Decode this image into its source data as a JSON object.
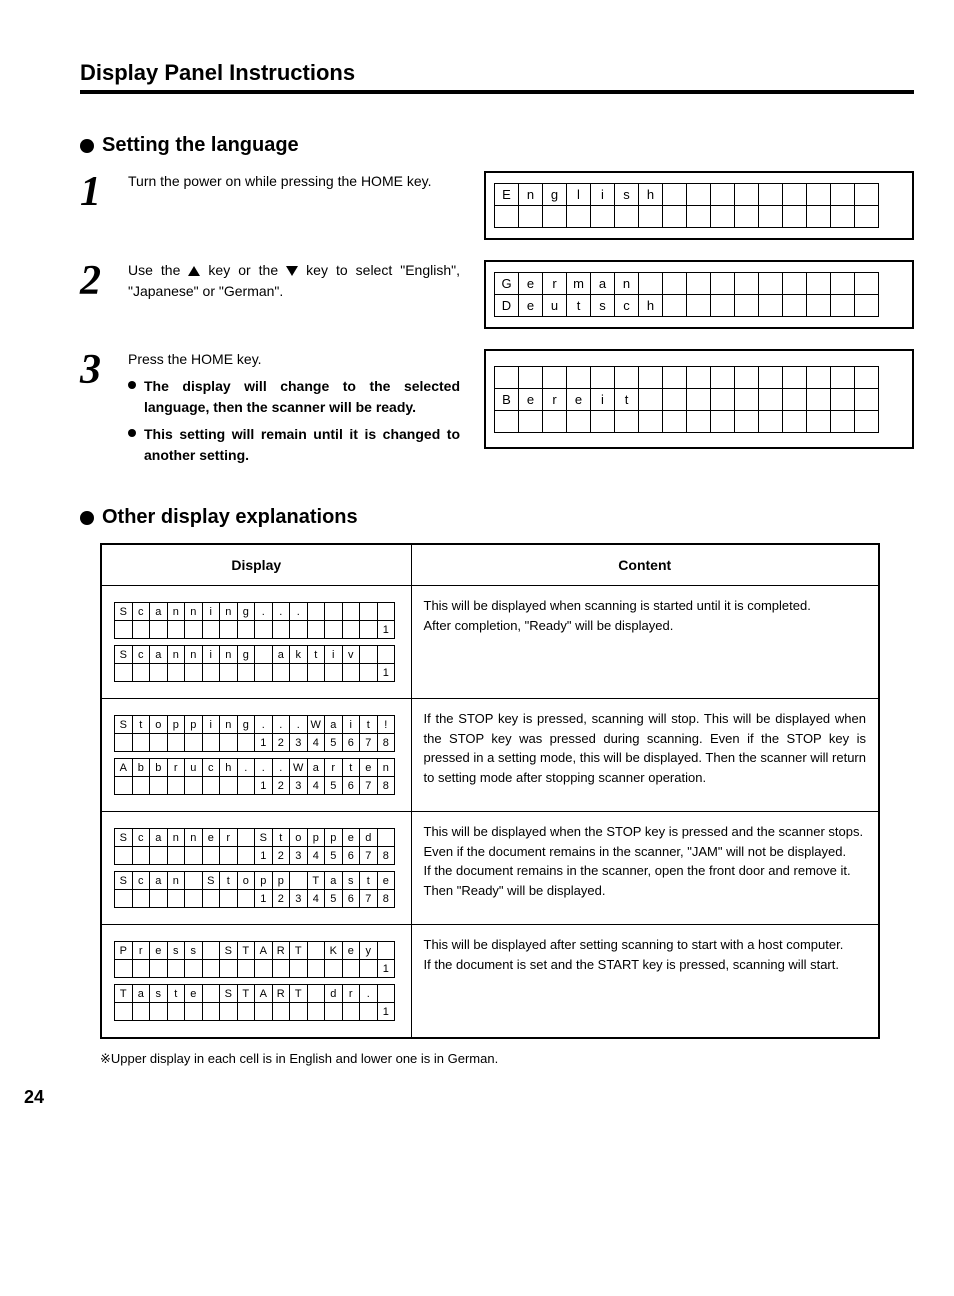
{
  "title": "Display Panel Instructions",
  "section1": {
    "heading": "Setting the language",
    "steps": [
      {
        "num": "1",
        "text": "Turn the power on while pressing the HOME key.",
        "display": {
          "rows": [
            [
              "E",
              "n",
              "g",
              "l",
              "i",
              "s",
              "h",
              "",
              "",
              "",
              "",
              "",
              "",
              "",
              "",
              ""
            ],
            [
              "",
              "",
              "",
              "",
              "",
              "",
              "",
              "",
              "",
              "",
              "",
              "",
              "",
              "",
              "",
              ""
            ]
          ]
        }
      },
      {
        "num": "2",
        "text_pre": "Use the ",
        "text_mid": " key or the ",
        "text_post": " key to select \"English\", \"Japanese\" or \"German\".",
        "display": {
          "rows": [
            [
              "G",
              "e",
              "r",
              "m",
              "a",
              "n",
              "",
              "",
              "",
              "",
              "",
              "",
              "",
              "",
              "",
              ""
            ],
            [
              "D",
              "e",
              "u",
              "t",
              "s",
              "c",
              "h",
              "",
              "",
              "",
              "",
              "",
              "",
              "",
              "",
              ""
            ]
          ]
        }
      },
      {
        "num": "3",
        "text": "Press the HOME key.",
        "subs": [
          "The display will change to the selected language, then the scanner will be ready.",
          "This setting will remain until it is changed to another setting."
        ],
        "display": {
          "rows": [
            [
              "",
              "",
              "",
              "",
              "",
              "",
              "",
              "",
              "",
              "",
              "",
              "",
              "",
              "",
              "",
              ""
            ],
            [
              "B",
              "e",
              "r",
              "e",
              "i",
              "t",
              "",
              "",
              "",
              "",
              "",
              "",
              "",
              "",
              "",
              ""
            ],
            [
              "",
              "",
              "",
              "",
              "",
              "",
              "",
              "",
              "",
              "",
              "",
              "",
              "",
              "",
              "",
              ""
            ]
          ]
        }
      }
    ]
  },
  "section2": {
    "heading": "Other display explanations",
    "col1": "Display",
    "col2": "Content",
    "rows": [
      {
        "grids": [
          [
            [
              "S",
              "c",
              "a",
              "n",
              "n",
              "i",
              "n",
              "g",
              ".",
              ".",
              ".",
              "",
              "",
              "",
              "",
              ""
            ],
            [
              "",
              "",
              "",
              "",
              "",
              "",
              "",
              "",
              "",
              "",
              "",
              "",
              "",
              "",
              "",
              "1"
            ]
          ],
          [
            [
              "S",
              "c",
              "a",
              "n",
              "n",
              "i",
              "n",
              "g",
              "",
              "a",
              "k",
              "t",
              "i",
              "v",
              "",
              ""
            ],
            [
              "",
              "",
              "",
              "",
              "",
              "",
              "",
              "",
              "",
              "",
              "",
              "",
              "",
              "",
              "",
              "1"
            ]
          ]
        ],
        "content": "This will be displayed when scanning is started until it is completed.\nAfter completion, \"Ready\" will be displayed."
      },
      {
        "grids": [
          [
            [
              "S",
              "t",
              "o",
              "p",
              "p",
              "i",
              "n",
              "g",
              ".",
              ".",
              ".",
              "W",
              "a",
              "i",
              "t",
              "!"
            ],
            [
              "",
              "",
              "",
              "",
              "",
              "",
              "",
              "",
              "1",
              "2",
              "3",
              "4",
              "5",
              "6",
              "7",
              "8"
            ]
          ],
          [
            [
              "A",
              "b",
              "b",
              "r",
              "u",
              "c",
              "h",
              ".",
              ".",
              ".",
              "W",
              "a",
              "r",
              "t",
              "e",
              "n"
            ],
            [
              "",
              "",
              "",
              "",
              "",
              "",
              "",
              "",
              "1",
              "2",
              "3",
              "4",
              "5",
              "6",
              "7",
              "8"
            ]
          ]
        ],
        "content": "If the STOP key is pressed, scanning will stop. This will be displayed when the STOP key was pressed during scanning. Even if the STOP key is pressed in a setting mode, this will be displayed. Then the scanner will return to setting mode after stopping scanner operation."
      },
      {
        "grids": [
          [
            [
              "S",
              "c",
              "a",
              "n",
              "n",
              "e",
              "r",
              "",
              "S",
              "t",
              "o",
              "p",
              "p",
              "e",
              "d",
              ""
            ],
            [
              "",
              "",
              "",
              "",
              "",
              "",
              "",
              "",
              "1",
              "2",
              "3",
              "4",
              "5",
              "6",
              "7",
              "8"
            ]
          ],
          [
            [
              "S",
              "c",
              "a",
              "n",
              "",
              "S",
              "t",
              "o",
              "p",
              "p",
              "",
              "T",
              "a",
              "s",
              "t",
              "e"
            ],
            [
              "",
              "",
              "",
              "",
              "",
              "",
              "",
              "",
              "1",
              "2",
              "3",
              "4",
              "5",
              "6",
              "7",
              "8"
            ]
          ]
        ],
        "content": "This will be displayed when the STOP key is pressed and the scanner stops.\nEven if the document remains in the scanner, \"JAM\" will not be displayed.\nIf the document remains in the scanner, open the front door and remove it.\nThen \"Ready\" will be displayed."
      },
      {
        "grids": [
          [
            [
              "P",
              "r",
              "e",
              "s",
              "s",
              "",
              "S",
              "T",
              "A",
              "R",
              "T",
              "",
              "K",
              "e",
              "y",
              ""
            ],
            [
              "",
              "",
              "",
              "",
              "",
              "",
              "",
              "",
              "",
              "",
              "",
              "",
              "",
              "",
              "",
              "1"
            ]
          ],
          [
            [
              "T",
              "a",
              "s",
              "t",
              "e",
              "",
              "S",
              "T",
              "A",
              "R",
              "T",
              "",
              "d",
              "r",
              ".",
              ""
            ],
            [
              "",
              "",
              "",
              "",
              "",
              "",
              "",
              "",
              "",
              "",
              "",
              "",
              "",
              "",
              "",
              "1"
            ]
          ]
        ],
        "content": "This will be displayed after setting scanning to start with a host computer.\nIf the document is set and the START key is pressed, scanning will start."
      }
    ],
    "footnote": "※Upper display in each cell is in English and lower one is in German."
  },
  "page_number": "24"
}
